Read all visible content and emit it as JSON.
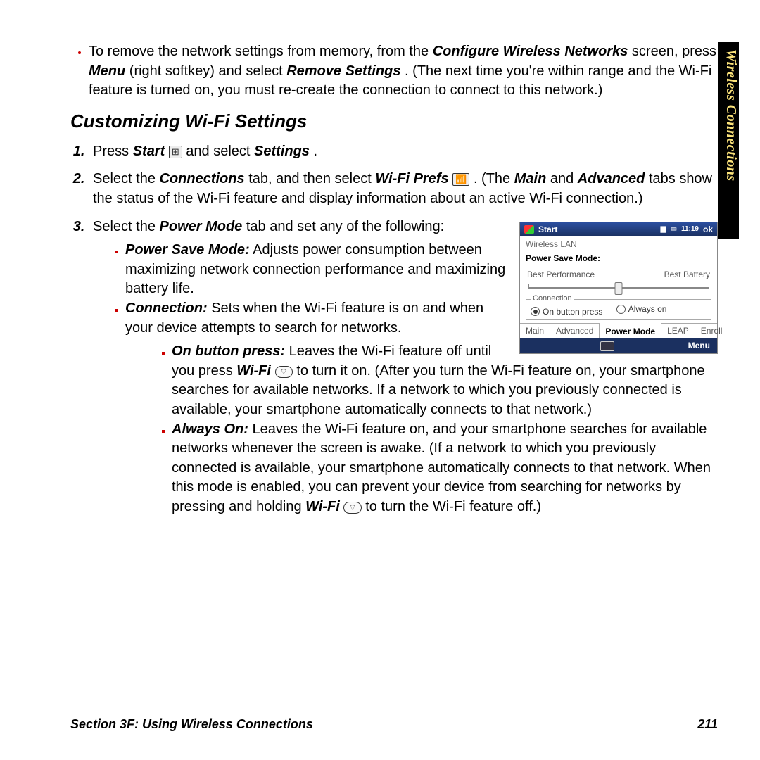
{
  "side_tab": "Wireless Connections",
  "intro_bullet": {
    "pre": "To remove the network settings from memory, from the ",
    "b1": "Configure Wireless Networks",
    "mid1": " screen, press ",
    "b2": "Menu",
    "mid2": " (right softkey) and select ",
    "b3": "Remove Settings",
    "post": ". (The next time you're within range and the Wi-Fi feature is turned on, you must re-create the connection to connect to this network.)"
  },
  "heading": "Customizing Wi-Fi Settings",
  "steps": {
    "one": {
      "a": "Press ",
      "b": "Start",
      "c": " and select ",
      "d": "Settings",
      "e": "."
    },
    "two": {
      "a": "Select the ",
      "b": "Connections",
      "c": " tab, and then select ",
      "d": "Wi-Fi Prefs",
      "e": " . (The ",
      "f": "Main",
      "g": " and ",
      "h": "Advanced",
      "i": " tabs show the status of the Wi-Fi feature and display information about an active Wi-Fi connection.)"
    },
    "three": {
      "a": "Select the ",
      "b": "Power Mode",
      "c": " tab and set any of the following:"
    }
  },
  "modes": {
    "psm": {
      "label": "Power Save Mode:",
      "text": " Adjusts power consumption between maximizing network connection performance and maximizing battery life."
    },
    "conn": {
      "label": "Connection:",
      "text": " Sets when the Wi-Fi feature is on and when your device attempts to search for networks."
    },
    "obp": {
      "label": "On button press:",
      "a": " Leaves the Wi-Fi feature off until you press ",
      "b": "Wi-Fi",
      "c": " to turn it on. (After you turn the Wi-Fi feature on, your smartphone searches for available networks. If a network to which you previously connected is available, your smartphone automatically connects to that network.)"
    },
    "always": {
      "label": "Always On:",
      "a": " Leaves the Wi-Fi feature on, and your smartphone searches for available networks whenever the screen is awake. (If a network to which you previously connected is available, your smartphone automatically connects to that network. When this mode is enabled, you can prevent your device from searching for networks by pressing and holding ",
      "b": "Wi-Fi",
      "c": " to turn the Wi-Fi feature off.)"
    }
  },
  "screenshot": {
    "start": "Start",
    "time": "11:19",
    "ok": "ok",
    "title": "Wireless LAN",
    "psm_label": "Power Save Mode:",
    "left": "Best Performance",
    "right": "Best Battery",
    "group": "Connection",
    "radio1": "On button press",
    "radio2": "Always on",
    "tabs": [
      "Main",
      "Advanced",
      "Power Mode",
      "LEAP",
      "Enroll"
    ],
    "menu": "Menu"
  },
  "icons": {
    "start": "⊞",
    "wifi_prefs": "📶",
    "wifi_key": "⌔"
  },
  "footer": {
    "left": "Section 3F: Using Wireless Connections",
    "right": "211"
  }
}
